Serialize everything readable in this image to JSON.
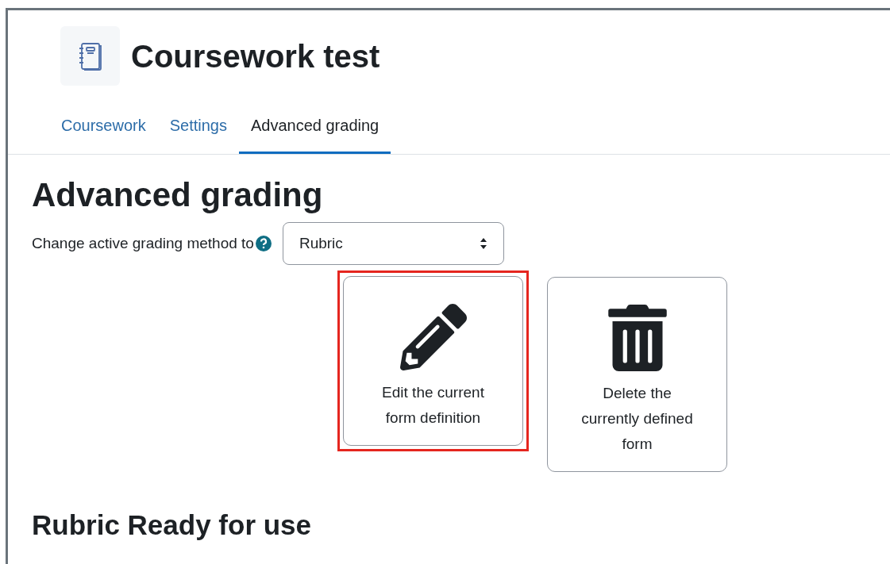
{
  "header": {
    "title": "Coursework test"
  },
  "tabs": [
    {
      "label": "Coursework",
      "selected": false
    },
    {
      "label": "Settings",
      "selected": false
    },
    {
      "label": "Advanced grading",
      "selected": true
    }
  ],
  "heading": "Advanced grading",
  "method": {
    "label": "Change active grading method to",
    "value": "Rubric"
  },
  "actions": [
    {
      "kind": "edit",
      "lines": [
        "Edit the current",
        "form definition"
      ],
      "highlighted": true
    },
    {
      "kind": "delete",
      "lines": [
        "Delete the",
        "currently defined",
        "form"
      ],
      "highlighted": false
    }
  ],
  "status_heading": "Rubric Ready for use"
}
